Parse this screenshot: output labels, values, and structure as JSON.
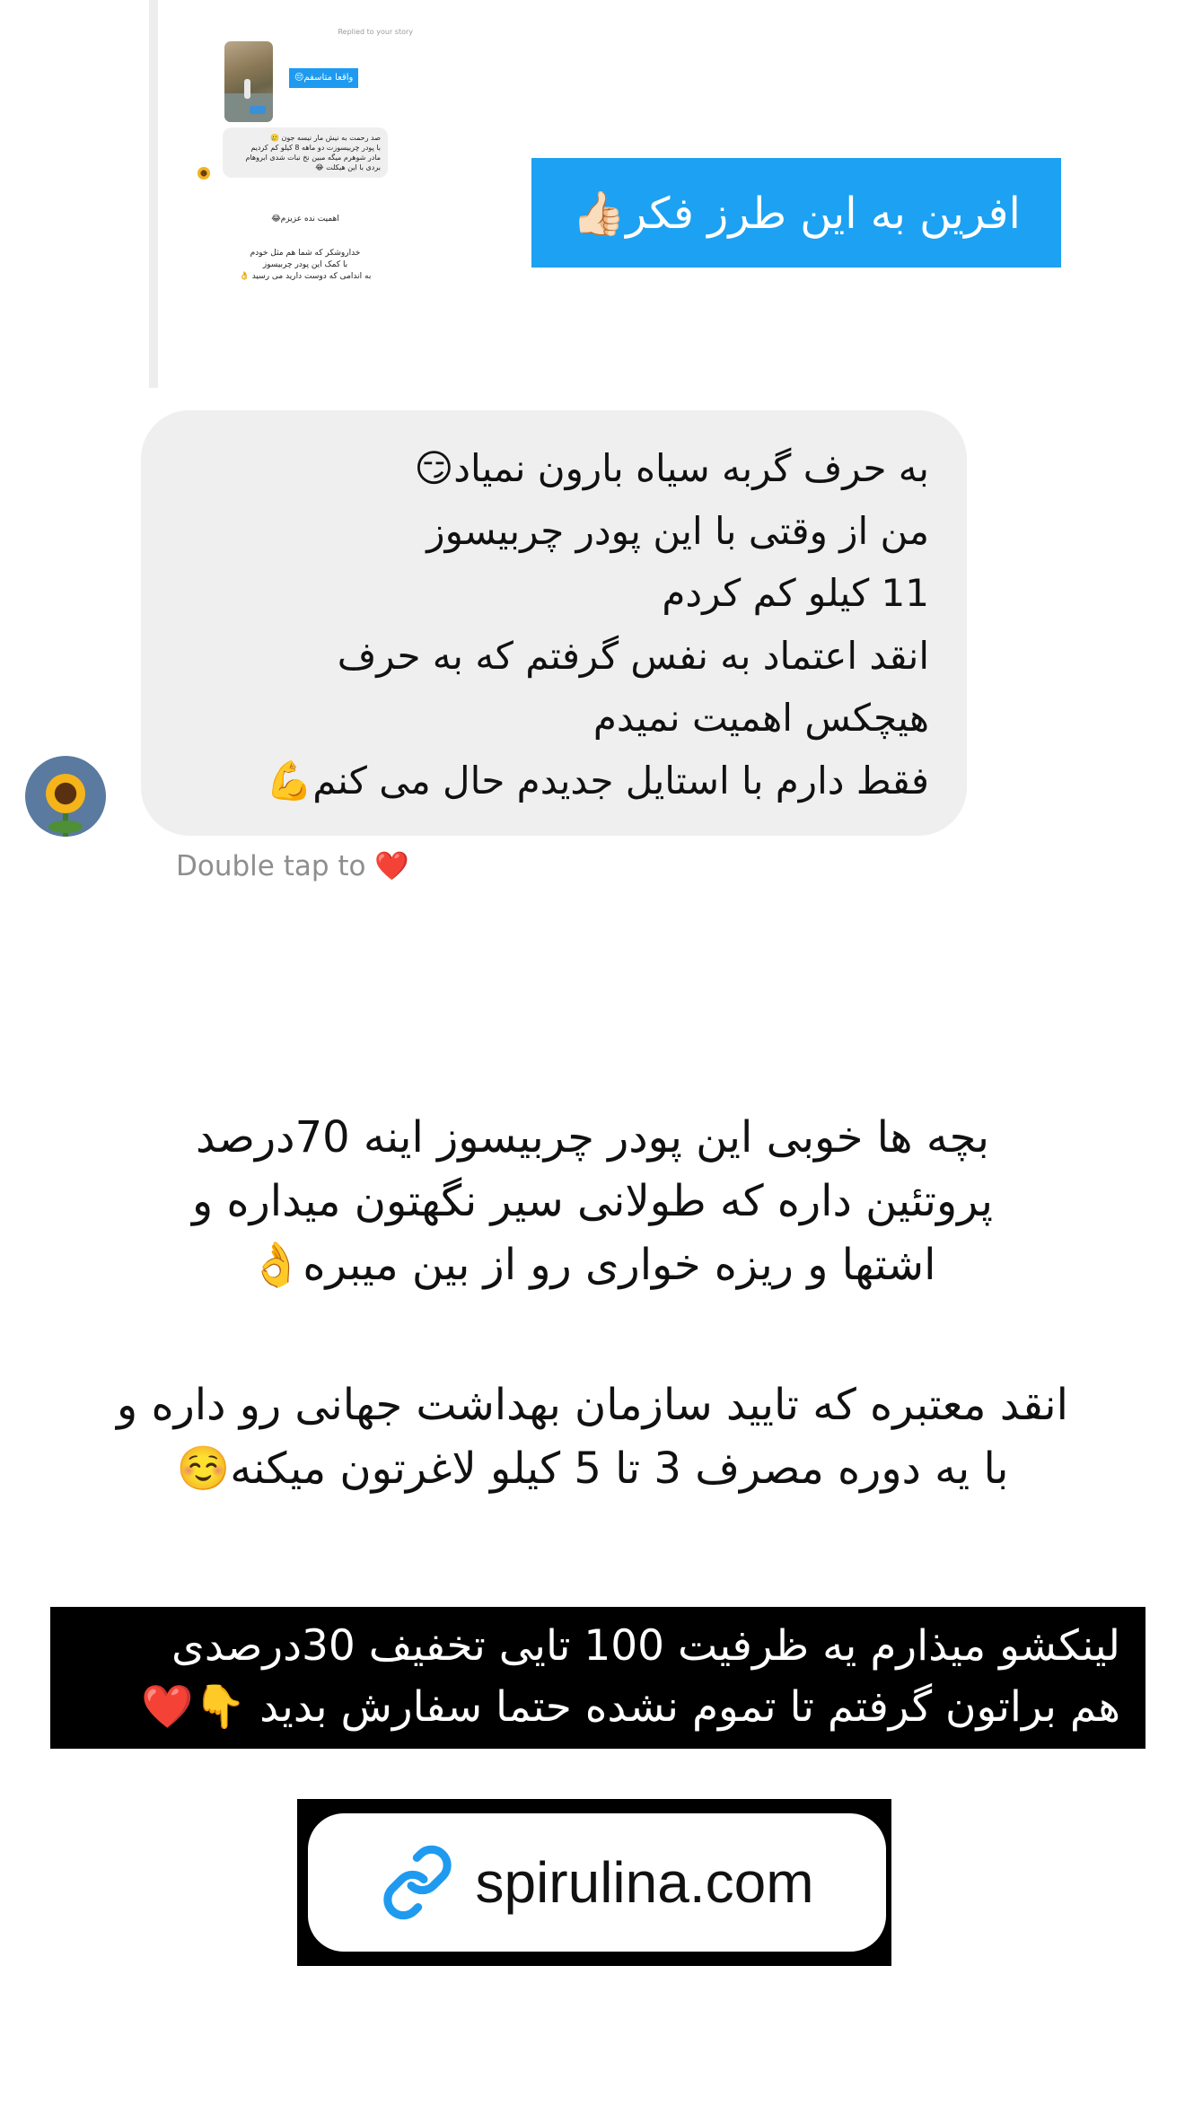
{
  "reply_thread": {
    "replied_label": "Replied to your story",
    "story_chip": "واقعا متاسفم😔",
    "bubble_lines": [
      "صد رحمت به نیش مار نیسه جون 🥲",
      "با پودر چربیسوزت دو ماهه 8 کیلو کم کردیم",
      "مادر شوهرم میگه مبین نخ نبات شدی ابروهام",
      "بردی با این هیکلت 😂"
    ],
    "reply_line": "اهمیت نده عزیزم😂",
    "reply_lines_2": [
      "خداروشکر که شما هم مثل خودم",
      "با کمک این پودر چربیسوز",
      "به اندامی که دوست دارید می رسید 👌"
    ]
  },
  "banner": {
    "text": "افرین به این طرز فکر👍🏻"
  },
  "message": {
    "lines": [
      "به حرف گربه سیاه بارون نمیاد😏",
      "من از وقتی با این پودر چربیسوز",
      "11 کیلو کم کردم",
      "انقد اعتماد به نفس گرفتم که به حرف",
      "هیچکس اهمیت نمیدم",
      "فقط دارم با استایل جدیدم حال می کنم💪"
    ],
    "double_tap": "Double tap to ❤️"
  },
  "paragraph_1": [
    "بچه ها خوبی این پودر چربیسوز اینه  70درصد",
    "پروتئین داره که طولانی سیر نگهتون میداره و",
    "اشتها و ریزه خواری رو از بین میبره👌"
  ],
  "paragraph_2": [
    "انقد معتبره که تایید سازمان بهداشت جهانی رو داره و",
    "با یه دوره مصرف 3 تا 5 کیلو لاغرتون میکنه☺️"
  ],
  "promo": {
    "lines": [
      "لینکشو میذارم یه ظرفیت 100 تایی تخفیف 30درصدی",
      "هم براتون گرفتم تا تموم نشده حتما سفارش بدید 👇❤️"
    ]
  },
  "link_sticker": {
    "icon": "link-icon",
    "url": "spirulina.com",
    "icon_color": "#1e9bf0"
  },
  "colors": {
    "banner_blue": "#1da1f2",
    "bubble_gray": "#efefef",
    "promo_bg": "#000000"
  }
}
